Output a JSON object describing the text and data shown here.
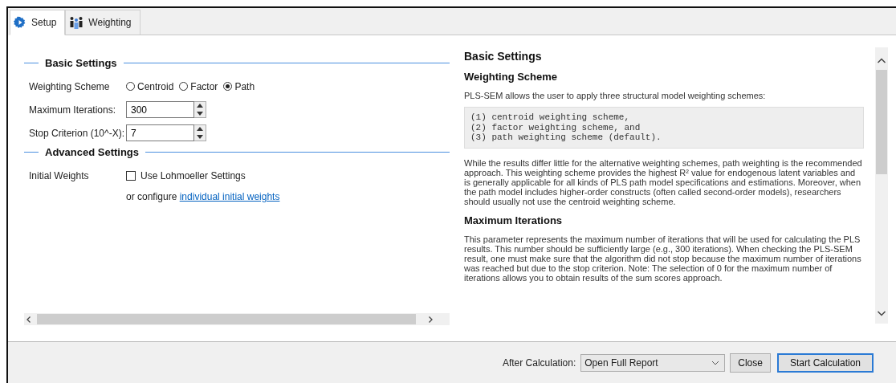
{
  "tabs": [
    {
      "label": "Setup",
      "kind": "gear",
      "selected": true
    },
    {
      "label": "Weighting",
      "kind": "people",
      "selected": false
    }
  ],
  "settings": {
    "sections": [
      {
        "title": "Basic Settings",
        "rows": [
          {
            "kind": "radio",
            "label": "Weighting Scheme",
            "options": [
              {
                "label": "Centroid",
                "selected": false
              },
              {
                "label": "Factor",
                "selected": false
              },
              {
                "label": "Path",
                "selected": true
              }
            ]
          },
          {
            "kind": "spinner",
            "label": "Maximum Iterations:",
            "value": "300"
          },
          {
            "kind": "spinner",
            "label": "Stop Criterion (10^-X):",
            "value": "7"
          }
        ]
      },
      {
        "title": "Advanced Settings",
        "rows": [
          {
            "kind": "checkbox",
            "label": "Initial Weights",
            "option": "Use Lohmoeller Settings",
            "checked": false,
            "note": "or configure",
            "link": "individual initial weights"
          }
        ]
      }
    ]
  },
  "help": {
    "title": "Basic Settings",
    "blocks": [
      {
        "kind": "heading",
        "text": "Weighting Scheme"
      },
      {
        "kind": "paragraph",
        "text": "PLS-SEM allows the user to apply three structural model weighting schemes:"
      },
      {
        "kind": "code",
        "lines": [
          "(1) centroid weighting scheme,",
          "(2) factor weighting scheme, and",
          "(3) path weighting scheme (default)."
        ]
      },
      {
        "kind": "paragraph",
        "text": "While the results differ little for the alternative weighting schemes, path weighting is the recommended approach. This weighting scheme provides the highest R² value for endogenous latent variables and is generally applicable for all kinds of PLS path model specifications and estimations. Moreover, when the path model includes higher-order constructs (often called second-order models), researchers should usually not use the centroid weighting scheme."
      },
      {
        "kind": "heading",
        "text": "Maximum Iterations"
      },
      {
        "kind": "paragraph",
        "text": "This parameter represents the maximum number of iterations that will be used for calculating the PLS results. This number should be sufficiently large (e.g., 300 iterations). When checking the PLS-SEM result, one must make sure that the algorithm did not stop because the maximum number of iterations was reached but due to the stop criterion. Note: The selection of 0 for the maximum number of iterations allows you to obtain results of the sum scores approach."
      }
    ]
  },
  "footer": {
    "label": "After Calculation:",
    "dropdown": "Open Full Report",
    "buttons": [
      {
        "label": "Close",
        "kind": "normal"
      },
      {
        "label": "Start Calculation",
        "kind": "default"
      }
    ]
  }
}
